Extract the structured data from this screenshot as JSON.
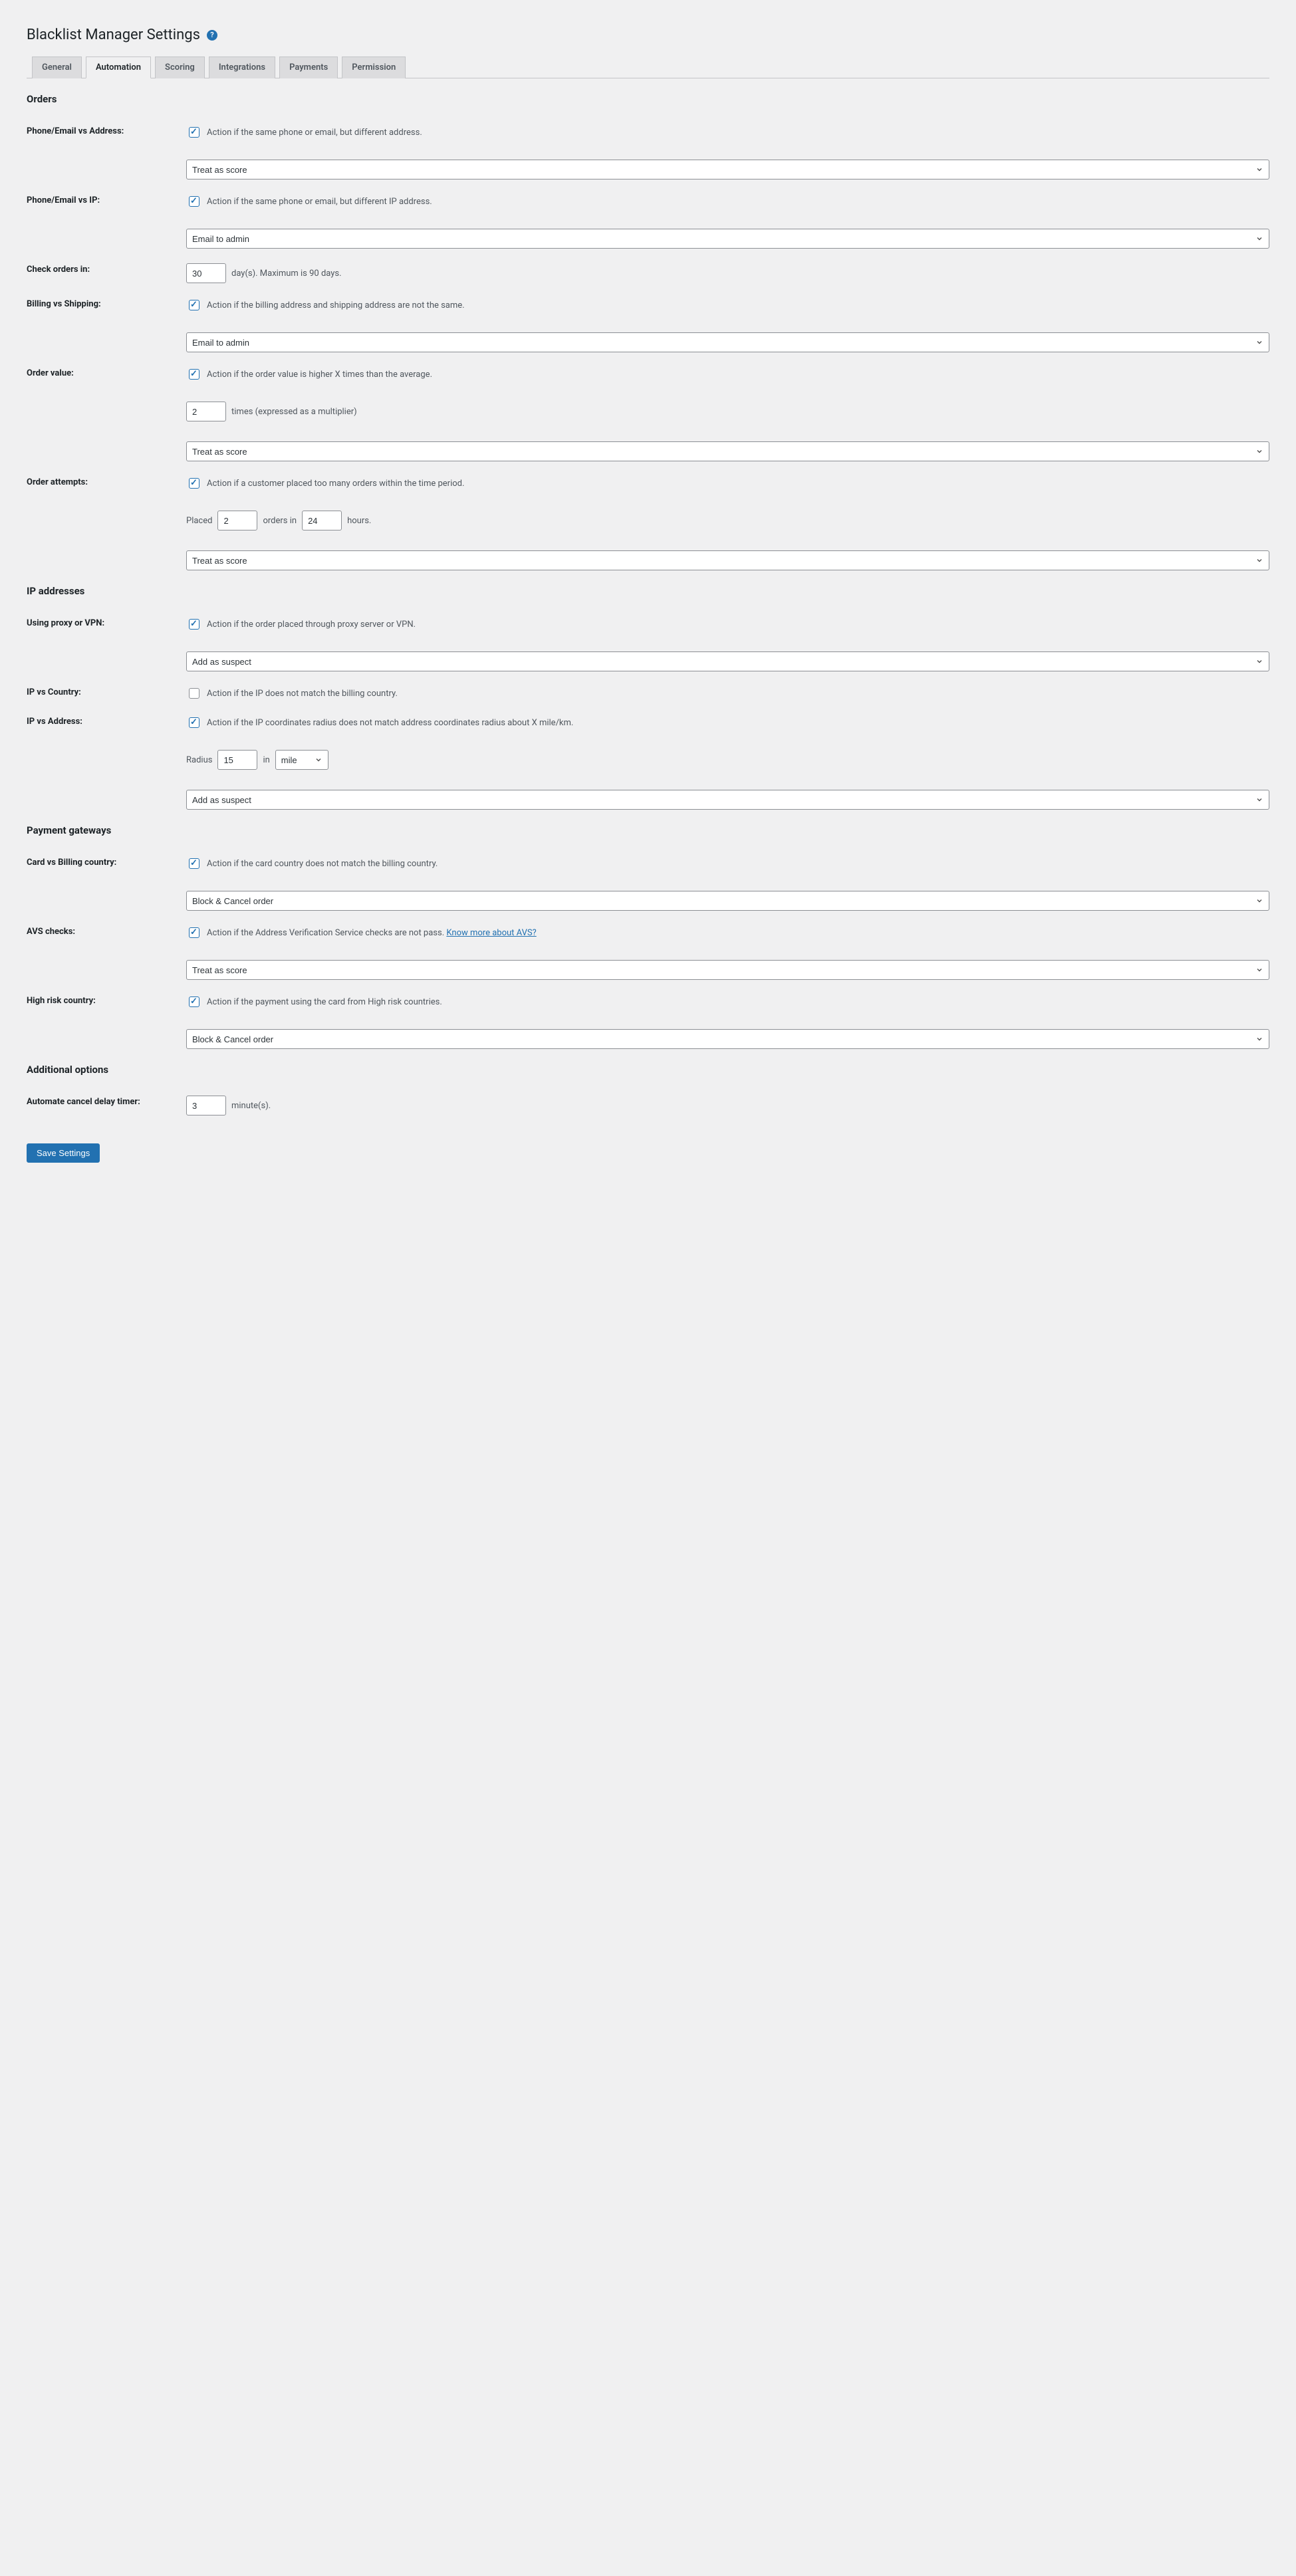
{
  "page": {
    "title": "Blacklist Manager Settings"
  },
  "tabs": {
    "general": "General",
    "automation": "Automation",
    "scoring": "Scoring",
    "integrations": "Integrations",
    "payments": "Payments",
    "permission": "Permission"
  },
  "sections": {
    "orders": "Orders",
    "ip": "IP addresses",
    "gateways": "Payment gateways",
    "additional": "Additional options"
  },
  "actions": {
    "treat_as_score": "Treat as score",
    "email_to_admin": "Email to admin",
    "add_as_suspect": "Add as suspect",
    "block_cancel": "Block & Cancel order"
  },
  "orders": {
    "phone_email_vs_address": {
      "label": "Phone/Email vs Address:",
      "checked": true,
      "desc": "Action if the same phone or email, but different address.",
      "action": "Treat as score"
    },
    "phone_email_vs_ip": {
      "label": "Phone/Email vs IP:",
      "checked": true,
      "desc": "Action if the same phone or email, but different IP address.",
      "action": "Email to admin"
    },
    "check_orders_in": {
      "label": "Check orders in:",
      "value": "30",
      "suffix": "day(s). Maximum is 90 days."
    },
    "billing_vs_shipping": {
      "label": "Billing vs Shipping:",
      "checked": true,
      "desc": "Action if the billing address and shipping address are not the same.",
      "action": "Email to admin"
    },
    "order_value": {
      "label": "Order value:",
      "checked": true,
      "desc": "Action if the order value is higher X times than the average.",
      "value": "2",
      "suffix": "times (expressed as a multiplier)",
      "action": "Treat as score"
    },
    "order_attempts": {
      "label": "Order attempts:",
      "checked": true,
      "desc": "Action if a customer placed too many orders within the time period.",
      "prefix": "Placed",
      "orders_value": "2",
      "mid": "orders in",
      "hours_value": "24",
      "suffix": "hours.",
      "action": "Treat as score"
    }
  },
  "ip": {
    "proxy_vpn": {
      "label": "Using proxy or VPN:",
      "checked": true,
      "desc": "Action if the order placed through proxy server or VPN.",
      "action": "Add as suspect"
    },
    "ip_vs_country": {
      "label": "IP vs Country:",
      "checked": false,
      "desc": "Action if the IP does not match the billing country."
    },
    "ip_vs_address": {
      "label": "IP vs Address:",
      "checked": true,
      "desc": "Action if the IP coordinates radius does not match address coordinates radius about X mile/km.",
      "radius_prefix": "Radius",
      "radius_value": "15",
      "in": "in",
      "unit": "mile",
      "action": "Add as suspect"
    }
  },
  "gateways": {
    "card_vs_country": {
      "label": "Card vs Billing country:",
      "checked": true,
      "desc": "Action if the card country does not match the billing country.",
      "action": "Block & Cancel order"
    },
    "avs": {
      "label": "AVS checks:",
      "checked": true,
      "desc": "Action if the Address Verification Service checks are not pass. ",
      "link": "Know more about AVS?",
      "action": "Treat as score"
    },
    "high_risk": {
      "label": "High risk country:",
      "checked": true,
      "desc": "Action if the payment using the card from High risk countries.",
      "action": "Block & Cancel order"
    }
  },
  "additional": {
    "delay_timer": {
      "label": "Automate cancel delay timer:",
      "value": "3",
      "suffix": "minute(s)."
    }
  },
  "save_button": "Save Settings"
}
